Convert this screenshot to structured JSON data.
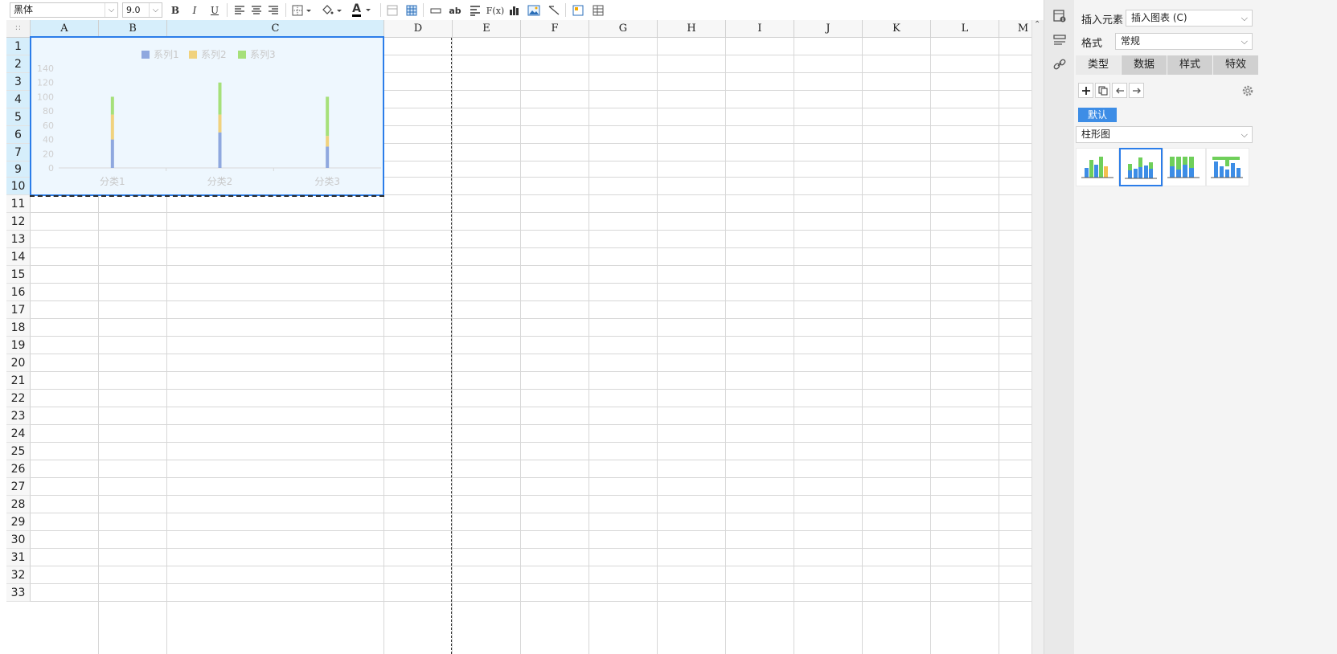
{
  "toolbar": {
    "font_name": "黑体",
    "font_size": "9.0",
    "bold": "B",
    "italic": "I",
    "underline": "U",
    "wrap_label": "ab",
    "formula_label": "F(x)",
    "font_color": "A"
  },
  "sheet": {
    "columns": [
      "A",
      "B",
      "C",
      "D",
      "E",
      "F",
      "G",
      "H",
      "I",
      "J",
      "K",
      "L",
      "M"
    ],
    "rows": [
      "1",
      "2",
      "3",
      "4",
      "5",
      "6",
      "7",
      "9",
      "10",
      "11",
      "12",
      "13",
      "14",
      "15",
      "16",
      "17",
      "18",
      "19",
      "20",
      "21",
      "22",
      "23",
      "24",
      "25",
      "26",
      "27",
      "28",
      "29",
      "30",
      "31",
      "32",
      "33"
    ]
  },
  "chart_data": {
    "type": "bar",
    "stacked": true,
    "categories": [
      "分类1",
      "分类2",
      "分类3"
    ],
    "series": [
      {
        "name": "系列1",
        "color": "#8fa8df",
        "values": [
          40,
          50,
          30
        ]
      },
      {
        "name": "系列2",
        "color": "#f0d27e",
        "values": [
          35,
          25,
          15
        ]
      },
      {
        "name": "系列3",
        "color": "#a6e07a",
        "values": [
          25,
          45,
          55
        ]
      }
    ],
    "y_ticks": [
      "0",
      "20",
      "40",
      "60",
      "80",
      "100",
      "120",
      "140"
    ],
    "ylim": [
      0,
      140
    ],
    "legend_position": "top"
  },
  "panel": {
    "insert_label": "插入元素",
    "insert_value": "插入图表 (C)",
    "format_label": "格式",
    "format_value": "常规",
    "tabs": [
      "类型",
      "数据",
      "样式",
      "特效"
    ],
    "default_tag": "默认",
    "chart_type": "柱形图"
  }
}
